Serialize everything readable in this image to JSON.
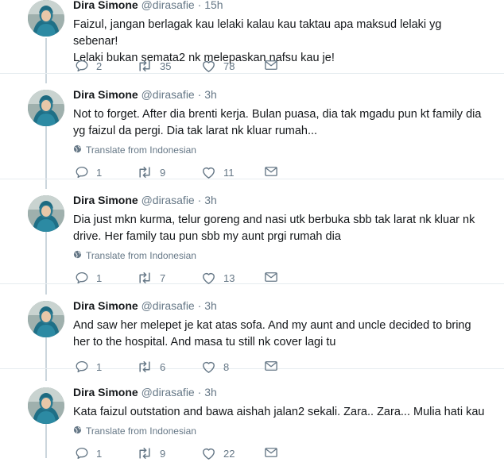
{
  "tweets": [
    {
      "name": "Dira Simone",
      "handle": "@dirasafie",
      "separator": "·",
      "time": "15h",
      "text": "Faizul, jangan berlagak kau lelaki kalau kau taktau apa maksud lelaki yg sebenar!\nLelaki bukan semata2 nk melepaskan nafsu kau je!",
      "translate": "",
      "replies": "2",
      "retweets": "35",
      "likes": "78"
    },
    {
      "name": "Dira Simone",
      "handle": "@dirasafie",
      "separator": "·",
      "time": "3h",
      "text": "Not to forget. After dia brenti kerja. Bulan puasa, dia tak mgadu pun kt family dia\nyg faizul da pergi. Dia tak larat nk kluar rumah...",
      "translate": "Translate from Indonesian",
      "replies": "1",
      "retweets": "9",
      "likes": "11"
    },
    {
      "name": "Dira Simone",
      "handle": "@dirasafie",
      "separator": "·",
      "time": "3h",
      "text": "Dia just mkn kurma, telur goreng and nasi utk berbuka sbb tak larat nk kluar nk\ndrive. Her family tau pun sbb my aunt prgi rumah dia",
      "translate": "Translate from Indonesian",
      "replies": "1",
      "retweets": "7",
      "likes": "13"
    },
    {
      "name": "Dira Simone",
      "handle": "@dirasafie",
      "separator": "·",
      "time": "3h",
      "text": "And saw her melepet je kat atas sofa. And my aunt and uncle decided to bring\nher to the hospital. And masa tu still nk cover lagi tu",
      "translate": "",
      "replies": "1",
      "retweets": "6",
      "likes": "8"
    },
    {
      "name": "Dira Simone",
      "handle": "@dirasafie",
      "separator": "·",
      "time": "3h",
      "text": "Kata faizul outstation and bawa aishah jalan2 sekali. Zara.. Zara... Mulia hati kau",
      "translate": "Translate from Indonesian",
      "replies": "1",
      "retweets": "9",
      "likes": "22"
    }
  ],
  "icons": {
    "reply": "reply-icon",
    "retweet": "retweet-icon",
    "like": "heart-icon",
    "dm": "envelope-icon",
    "translate": "globe-icon"
  },
  "colors": {
    "text": "#14171a",
    "secondary": "#657786",
    "thread_line": "#ccd6dd",
    "divider": "#e6ecf0"
  }
}
